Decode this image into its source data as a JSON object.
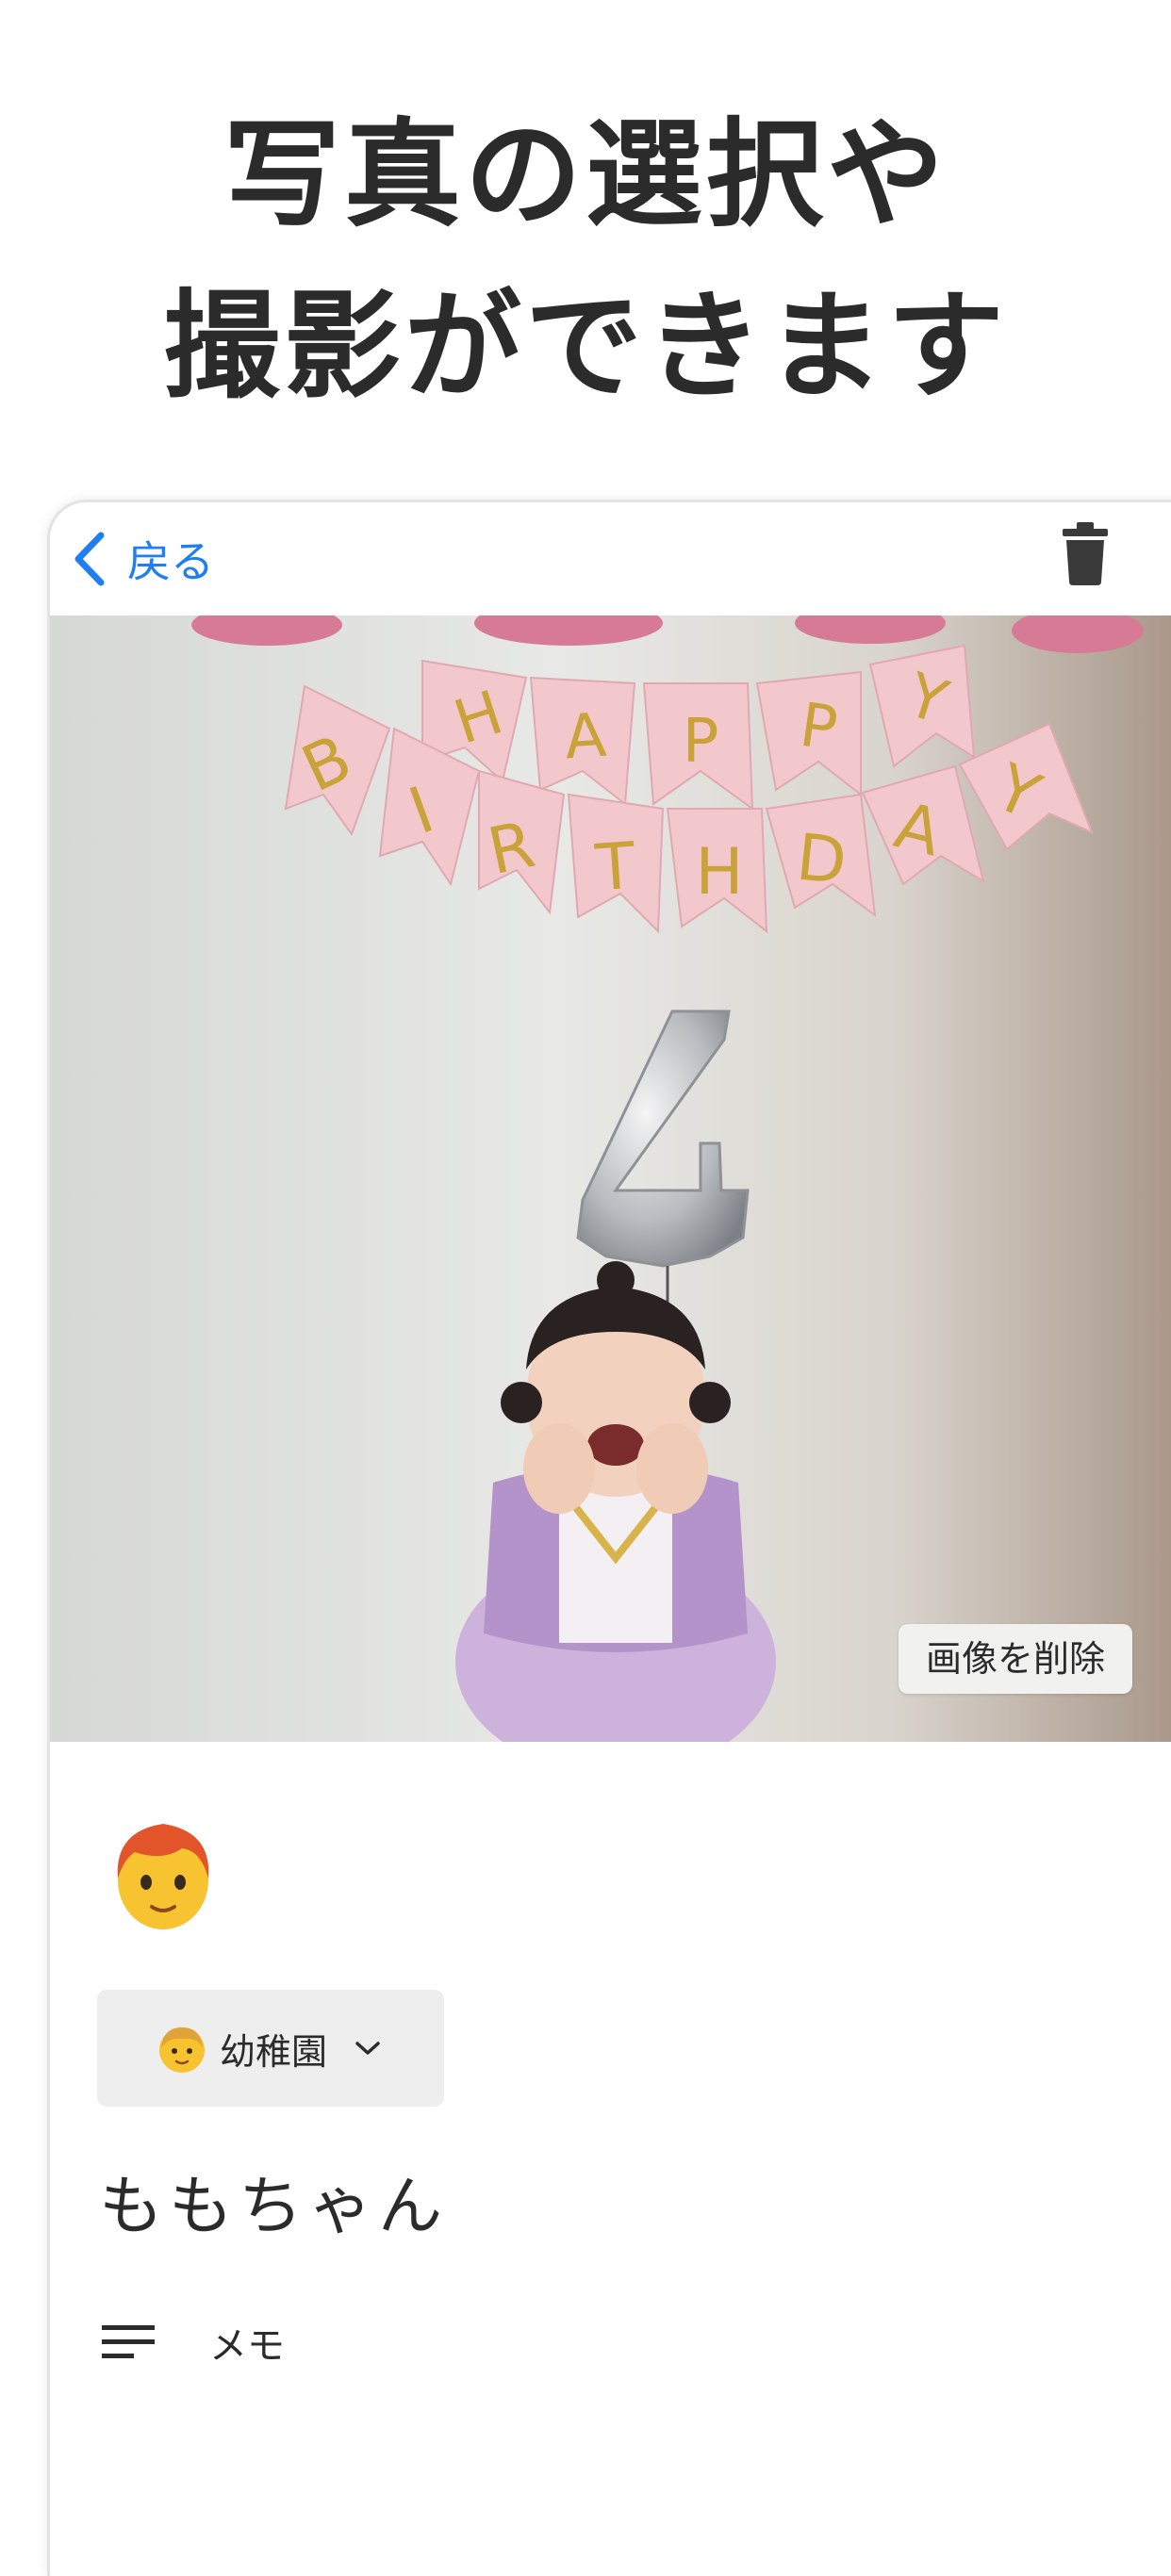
{
  "headline": {
    "line1": "写真の選択や",
    "line2": "撮影ができます"
  },
  "nav": {
    "back_label": "戻る",
    "accent_color": "#1f7ef2",
    "trash_icon": "trash-icon"
  },
  "photo": {
    "banner_top": "HAPPY",
    "banner_bottom": "BIRTHDAY",
    "balloon_number": "4",
    "delete_image_label": "画像を削除"
  },
  "form": {
    "emoji_icon": "person-emoji-icon",
    "category_label": "幼稚園",
    "child_name": "ももちゃん",
    "memo_placeholder": "メモ"
  }
}
